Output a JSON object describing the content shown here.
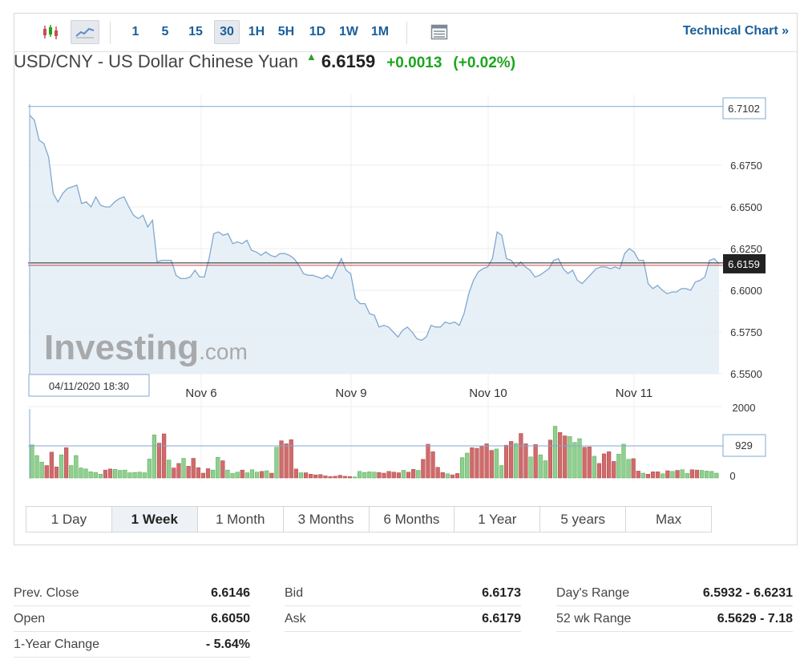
{
  "toolbar": {
    "intervals": [
      "1",
      "5",
      "15",
      "30",
      "1H",
      "5H",
      "1D",
      "1W",
      "1M"
    ],
    "active_interval": "30",
    "technical_chart": "Technical Chart »"
  },
  "quote": {
    "pair": "USD/CNY - US Dollar Chinese Yuan",
    "last": "6.6159",
    "change": "+0.0013",
    "change_pct": "(+0.02%)"
  },
  "colors": {
    "up": "#1ea51e",
    "down": "#c94d4d",
    "line": "#7fa8d0",
    "accent": "#1a5f9b"
  },
  "chart_data": {
    "type": "line",
    "price_axis": {
      "ticks": [
        "6.6750",
        "6.6500",
        "6.6250",
        "6.6000",
        "6.5750",
        "6.5500"
      ],
      "ylim": [
        6.55,
        6.7173
      ]
    },
    "x_ticks": [
      "Nov 6",
      "Nov 9",
      "Nov 10",
      "Nov 11"
    ],
    "start_label": "04/11/2020 18:30",
    "high_label": "6.7102",
    "current_label": "6.6159",
    "watermark": "Investing.com",
    "price": [
      6.705,
      6.702,
      6.69,
      6.688,
      6.68,
      6.658,
      6.653,
      6.658,
      6.661,
      6.662,
      6.663,
      6.652,
      6.653,
      6.65,
      6.656,
      6.651,
      6.65,
      6.65,
      6.653,
      6.655,
      6.656,
      6.65,
      6.645,
      6.643,
      6.645,
      6.638,
      6.642,
      6.617,
      6.618,
      6.618,
      6.618,
      6.609,
      6.607,
      6.607,
      6.608,
      6.612,
      6.608,
      6.608,
      6.619,
      6.634,
      6.635,
      6.633,
      6.634,
      6.628,
      6.629,
      6.628,
      6.63,
      6.624,
      6.623,
      6.621,
      6.623,
      6.621,
      6.62,
      6.622,
      6.622,
      6.621,
      6.619,
      6.615,
      6.61,
      6.609,
      6.609,
      6.608,
      6.607,
      6.609,
      6.607,
      6.613,
      6.619,
      6.612,
      6.61,
      6.595,
      6.592,
      6.592,
      6.586,
      6.585,
      6.578,
      6.579,
      6.578,
      6.575,
      6.572,
      6.576,
      6.578,
      6.575,
      6.571,
      6.57,
      6.572,
      6.579,
      6.578,
      6.578,
      6.581,
      6.58,
      6.581,
      6.579,
      6.586,
      6.598,
      6.606,
      6.611,
      6.613,
      6.614,
      6.619,
      6.635,
      6.633,
      6.619,
      6.618,
      6.614,
      6.617,
      6.614,
      6.612,
      6.608,
      6.609,
      6.611,
      6.613,
      6.618,
      6.619,
      6.613,
      6.61,
      6.612,
      6.606,
      6.604,
      6.607,
      6.61,
      6.613,
      6.614,
      6.614,
      6.613,
      6.614,
      6.613,
      6.622,
      6.625,
      6.623,
      6.618,
      6.618,
      6.604,
      6.601,
      6.603,
      6.6,
      6.598,
      6.599,
      6.599,
      6.601,
      6.601,
      6.6,
      6.605,
      6.606,
      6.608,
      6.618,
      6.619,
      6.6159
    ],
    "volume_axis": {
      "ticks": [
        "2000",
        "0"
      ],
      "ylim": [
        0,
        2000
      ],
      "reference_label": "929",
      "reference_value": 929
    },
    "volume_colors": "gggrrrgrgggggggrrgggggggggrrgrrgrrrrrggrgggrgggrgrgrrrrgrrrrrrrrrrgggggrrrrrgrrgrrrrrgrrggrrrrrggrrgrrgrggrgrrgggrrgrrrrgggrrgrrrgrgrggrrggggrrgrrgggggggrrgggggggr",
    "volume": [
      960,
      650,
      460,
      360,
      750,
      320,
      670,
      880,
      360,
      650,
      290,
      260,
      180,
      160,
      110,
      230,
      260,
      250,
      220,
      230,
      150,
      160,
      170,
      150,
      550,
      1250,
      1010,
      1280,
      520,
      290,
      420,
      570,
      340,
      570,
      300,
      140,
      270,
      230,
      600,
      500,
      230,
      130,
      170,
      230,
      150,
      240,
      170,
      190,
      210,
      140,
      890,
      1080,
      990,
      1110,
      260,
      150,
      150,
      110,
      90,
      100,
      60,
      40,
      50,
      80,
      50,
      40,
      30,
      190,
      160,
      180,
      170,
      160,
      140,
      190,
      170,
      150,
      220,
      170,
      250,
      220,
      540,
      980,
      760,
      310,
      160,
      120,
      90,
      130,
      590,
      720,
      880,
      860,
      910,
      990,
      800,
      840,
      360,
      950,
      1060,
      1000,
      1290,
      990,
      610,
      970,
      670,
      500,
      1100,
      1500,
      1320,
      1220,
      1200,
      1030,
      1140,
      890,
      900,
      630,
      420,
      700,
      760,
      480,
      690,
      980,
      540,
      560,
      200,
      140,
      110,
      180,
      180,
      120,
      210,
      190,
      220,
      240,
      130,
      240,
      230,
      220,
      200,
      190,
      140
    ]
  },
  "ranges": [
    "1 Day",
    "1 Week",
    "1 Month",
    "3 Months",
    "6 Months",
    "1 Year",
    "5 years",
    "Max"
  ],
  "active_range": "1 Week",
  "stats": [
    [
      {
        "label": "Prev. Close",
        "value": "6.6146"
      },
      {
        "label": "Open",
        "value": "6.6050"
      },
      {
        "label": "1-Year Change",
        "value": "- 5.64%"
      }
    ],
    [
      {
        "label": "Bid",
        "value": "6.6173"
      },
      {
        "label": "Ask",
        "value": "6.6179"
      }
    ],
    [
      {
        "label": "Day's Range",
        "value": "6.5932 - 6.6231"
      },
      {
        "label": "52 wk Range",
        "value": "6.5629 - 7.18"
      }
    ]
  ]
}
